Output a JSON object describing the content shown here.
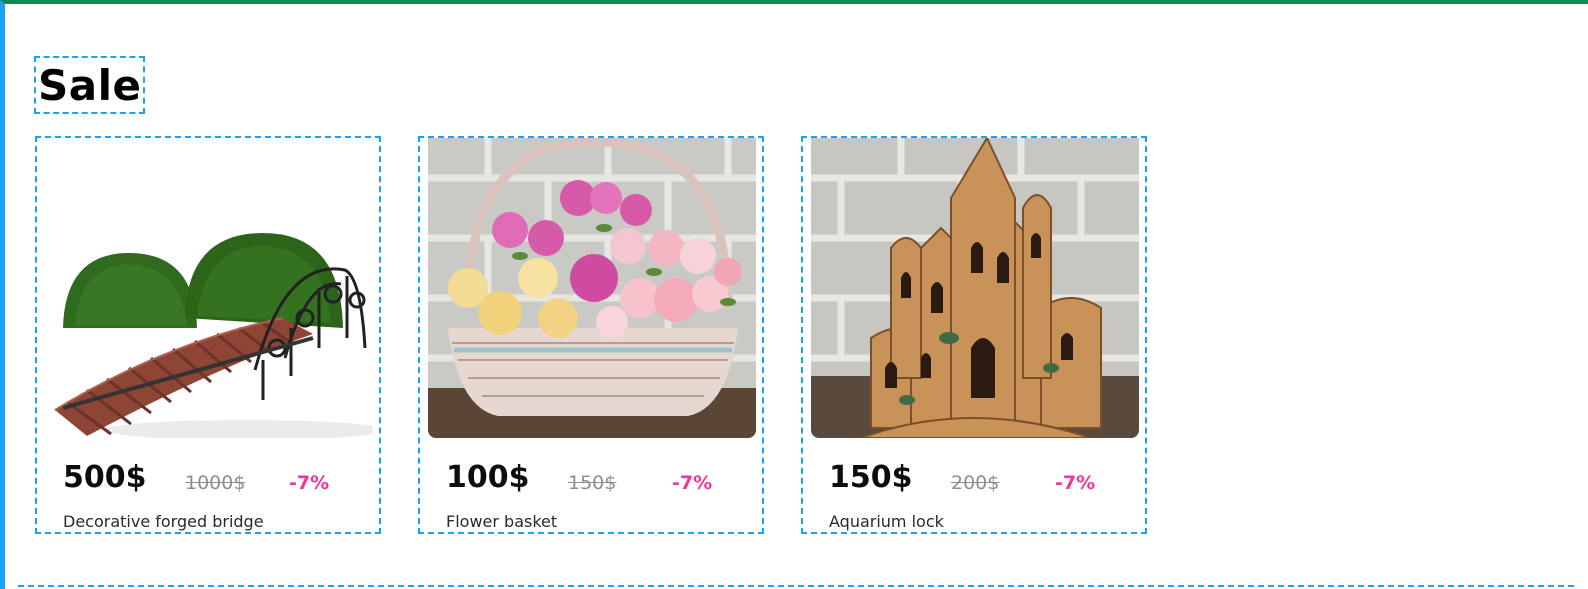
{
  "section": {
    "title": "Sale"
  },
  "products": [
    {
      "price": "500$",
      "old_price": "1000$",
      "discount": "-7%",
      "name": "Decorative forged bridge",
      "image_icon": "decorative-bridge-photo"
    },
    {
      "price": "100$",
      "old_price": "150$",
      "discount": "-7%",
      "name": "Flower basket",
      "image_icon": "flower-basket-photo"
    },
    {
      "price": "150$",
      "old_price": "200$",
      "discount": "-7%",
      "name": "Aquarium lock",
      "image_icon": "aquarium-castle-photo"
    }
  ],
  "colors": {
    "accent_border": "#1aa3f2",
    "discount": "#f0359b",
    "old_price": "#8f8f8f",
    "top_bar": "#0f8a52"
  }
}
